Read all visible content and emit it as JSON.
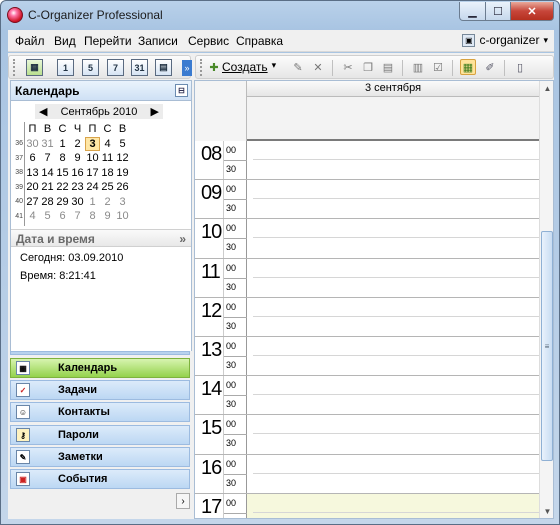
{
  "window": {
    "title": "C-Organizer Professional",
    "min_icon": "minimize-icon",
    "max_icon": "maximize-icon",
    "close_icon": "close-icon"
  },
  "menu": {
    "items": [
      "Файл",
      "Вид",
      "Перейти",
      "Записи",
      "Сервис",
      "Справка"
    ],
    "user": "c-organizer"
  },
  "left_toolbar": {
    "buttons": [
      "1",
      "5",
      "7",
      "31"
    ]
  },
  "right_toolbar": {
    "create_label": "Создать"
  },
  "calendar_panel": {
    "title": "Календарь",
    "month": "Сентябрь 2010",
    "weekday_headers": [
      "П",
      "В",
      "С",
      "Ч",
      "П",
      "С",
      "В"
    ],
    "weeks": [
      {
        "week": "36",
        "days": [
          "30",
          "31",
          "1",
          "2",
          "3",
          "4",
          "5"
        ]
      },
      {
        "week": "37",
        "days": [
          "6",
          "7",
          "8",
          "9",
          "10",
          "11",
          "12"
        ]
      },
      {
        "week": "38",
        "days": [
          "13",
          "14",
          "15",
          "16",
          "17",
          "18",
          "19"
        ]
      },
      {
        "week": "39",
        "days": [
          "20",
          "21",
          "22",
          "23",
          "24",
          "25",
          "26"
        ]
      },
      {
        "week": "40",
        "days": [
          "27",
          "28",
          "29",
          "30",
          "1",
          "2",
          "3"
        ]
      },
      {
        "week": "41",
        "days": [
          "4",
          "5",
          "6",
          "7",
          "8",
          "9",
          "10"
        ]
      }
    ],
    "selected_day": "3"
  },
  "datetime_panel": {
    "title": "Дата и время",
    "today": "Сегодня: 03.09.2010",
    "time": "Время: 8:21:41"
  },
  "nav": {
    "items": [
      "Календарь",
      "Задачи",
      "Контакты",
      "Пароли",
      "Заметки",
      "События"
    ],
    "active": "Календарь"
  },
  "day_view": {
    "date_header": "3 сентября",
    "hours": [
      "08",
      "09",
      "10",
      "11",
      "12",
      "13",
      "14",
      "15",
      "16",
      "17"
    ],
    "minute_labels": [
      "00",
      "30"
    ]
  },
  "colors": {
    "accent": "#4a90d9",
    "active_nav": "#94d24c",
    "selected_day": "#ffe7a6",
    "off_hours": "#f6f8dd"
  }
}
